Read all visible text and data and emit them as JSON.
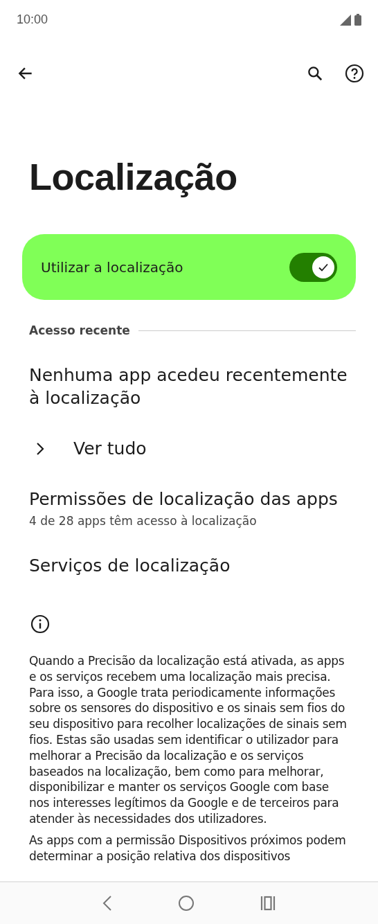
{
  "status_bar": {
    "time": "10:00"
  },
  "title": "Localização",
  "main_switch": {
    "label": "Utilizar a localização",
    "on": true
  },
  "section": {
    "header": "Acesso recente"
  },
  "items": [
    {
      "kind": "text",
      "title": "Nenhuma app acedeu recentemente à localização"
    },
    {
      "kind": "link",
      "title": "Ver tudo"
    },
    {
      "kind": "text",
      "title": "Permissões de localização das apps",
      "subtitle": "4 de 28 apps têm acesso à localização"
    },
    {
      "kind": "text",
      "title": "Serviços de localização"
    }
  ],
  "info_text": "Quando a Precisão da localização está ativada, as apps e os serviços recebem uma localização mais precisa. Para isso, a Google trata periodicamente informações sobre os sensores do dispositivo e os sinais sem fios do seu dispositivo para recolher localizações de sinais sem fios. Estas são usadas sem identificar o utilizador para melhorar a Precisão da localização e os serviços baseados na localização, bem como para melhorar, disponibilizar e manter os serviços Google com base nos interesses legítimos da Google e de terceiros para atender às necessidades dos utilizadores.",
  "faded_text": "As apps com a permissão Dispositivos próximos podem determinar a posição relativa dos dispositivos"
}
